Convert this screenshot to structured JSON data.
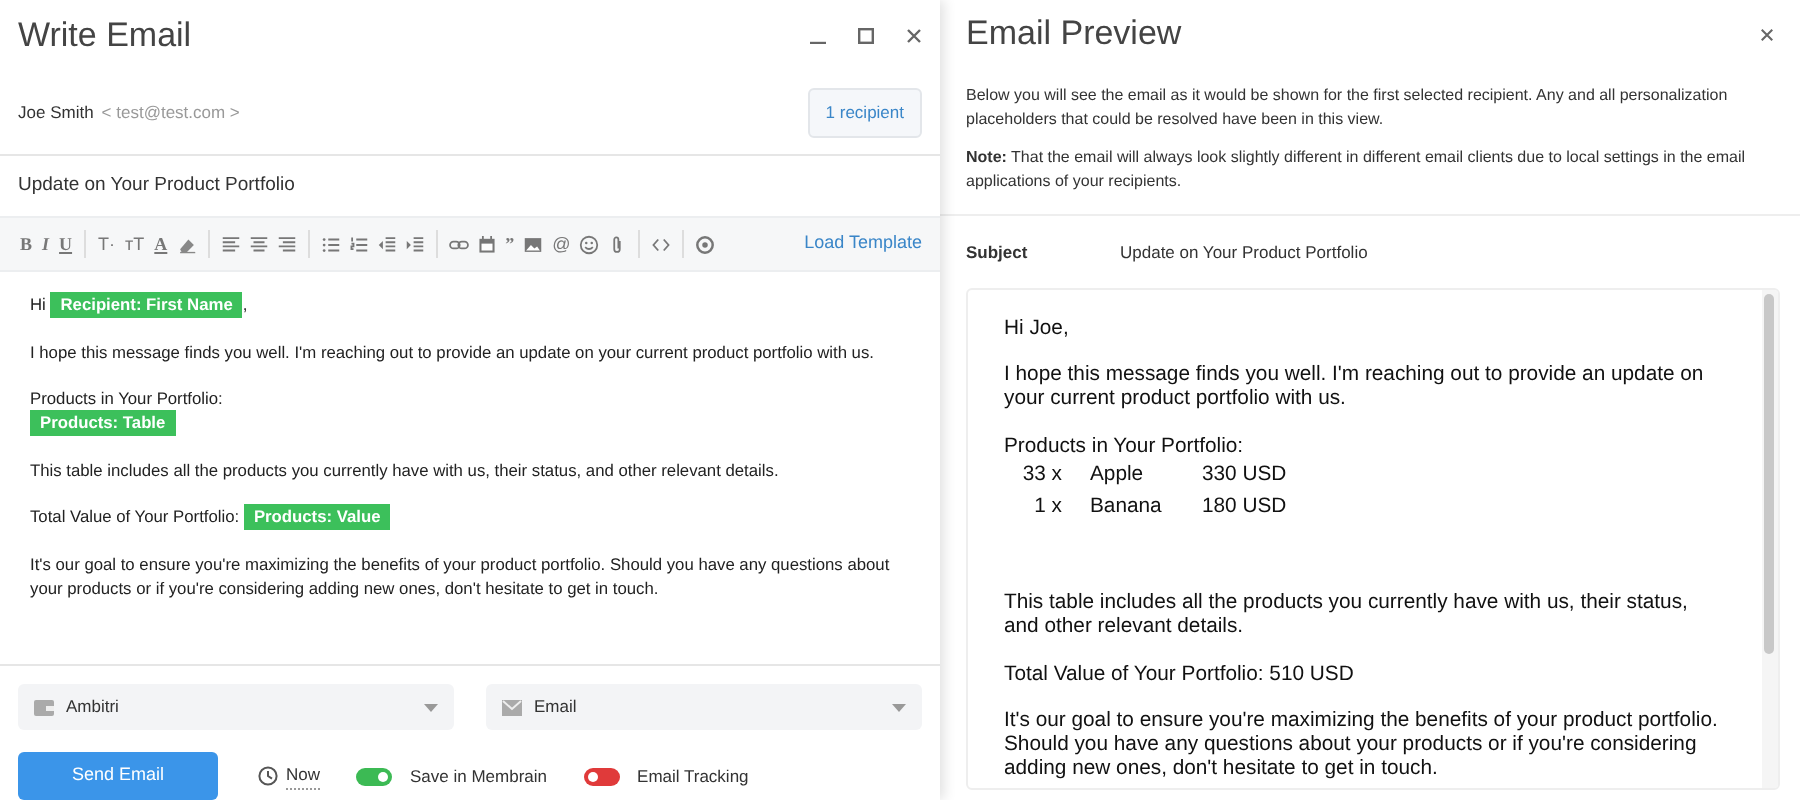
{
  "compose": {
    "title": "Write Email",
    "sender": {
      "name": "Joe Smith",
      "email": "< test@test.com >"
    },
    "recipients_button": "1 recipient",
    "subject": "Update on Your Product Portfolio",
    "toolbar": [
      {
        "kind": "bold",
        "label": "B"
      },
      {
        "kind": "italic",
        "label": "I"
      },
      {
        "kind": "underline",
        "label": "U"
      },
      {
        "kind": "separator"
      },
      {
        "kind": "glyph",
        "label": "T·"
      },
      {
        "kind": "glyph",
        "label": "ᴛT"
      },
      {
        "kind": "underline",
        "label": "A"
      },
      {
        "kind": "eraser"
      },
      {
        "kind": "separator"
      },
      {
        "kind": "align-left"
      },
      {
        "kind": "align-center"
      },
      {
        "kind": "align-right"
      },
      {
        "kind": "separator"
      },
      {
        "kind": "bullet-list"
      },
      {
        "kind": "numbered-list"
      },
      {
        "kind": "outdent"
      },
      {
        "kind": "indent"
      },
      {
        "kind": "separator"
      },
      {
        "kind": "link"
      },
      {
        "kind": "calendar"
      },
      {
        "kind": "bold",
        "label": "”"
      },
      {
        "kind": "image"
      },
      {
        "kind": "glyph",
        "label": "@"
      },
      {
        "kind": "smiley"
      },
      {
        "kind": "paperclip"
      },
      {
        "kind": "separator"
      },
      {
        "kind": "code"
      },
      {
        "kind": "separator"
      },
      {
        "kind": "preview"
      }
    ],
    "load_template": "Load Template",
    "body": [
      {
        "parts": [
          {
            "kind": "text",
            "text": "Hi "
          },
          {
            "kind": "placeholder",
            "text": "Recipient: First Name"
          },
          {
            "kind": "text",
            "text": ","
          }
        ]
      },
      {
        "parts": [
          {
            "kind": "text",
            "text": "I hope this message finds you well. I'm reaching out to provide an update on your current product portfolio with us."
          }
        ]
      },
      {
        "parts": [
          {
            "kind": "text",
            "text": "Products in Your Portfolio:"
          },
          {
            "kind": "break"
          },
          {
            "kind": "placeholder",
            "text": "Products: Table"
          }
        ]
      },
      {
        "parts": [
          {
            "kind": "text",
            "text": "This table includes all the products you currently have with us, their status, and other relevant details."
          }
        ]
      },
      {
        "parts": [
          {
            "kind": "text",
            "text": "Total Value of Your Portfolio: "
          },
          {
            "kind": "placeholder",
            "text": "Products: Value"
          }
        ]
      },
      {
        "parts": [
          {
            "kind": "text",
            "text": "It's our goal to ensure you're maximizing the benefits of your product portfolio. Should you have any questions about your products or if you're considering adding new ones, don't hesitate to get in touch."
          }
        ]
      }
    ],
    "account_select": "Ambitri",
    "channel_select": "Email",
    "send_button": "Send Email",
    "schedule": "Now",
    "toggles": [
      {
        "label": "Save in Membrain",
        "on": true
      },
      {
        "label": "Email Tracking",
        "on": false
      }
    ]
  },
  "preview": {
    "title": "Email Preview",
    "description": "Below you will see the email as it would be shown for the first selected recipient. Any and all personalization placeholders that could be resolved have been in this view.",
    "note": "**Note:** That the email will always look slightly different in different email clients due to local settings in the email applications of your recipients.",
    "subject_label": "Subject",
    "subject": "Update on Your Product Portfolio",
    "body": [
      {
        "kind": "paragraph",
        "text": "Hi Joe,"
      },
      {
        "kind": "paragraph",
        "text": "I hope this message finds you well. I'm reaching out to provide an update on your current product portfolio with us."
      },
      {
        "kind": "table",
        "heading": "Products in Your Portfolio:",
        "rows": [
          [
            "33 x",
            "Apple",
            "330 USD"
          ],
          [
            "1 x",
            "Banana",
            "180 USD"
          ]
        ]
      },
      {
        "kind": "paragraph",
        "text": "This table includes all the products you currently have with us, their status, and other relevant details."
      },
      {
        "kind": "paragraph",
        "text": "Total Value of Your Portfolio: 510 USD"
      },
      {
        "kind": "paragraph",
        "text": "It's our goal to ensure you're maximizing the benefits of your product portfolio. Should you have any questions about your products or if you're considering adding new ones, don't hesitate to get in touch."
      }
    ]
  }
}
